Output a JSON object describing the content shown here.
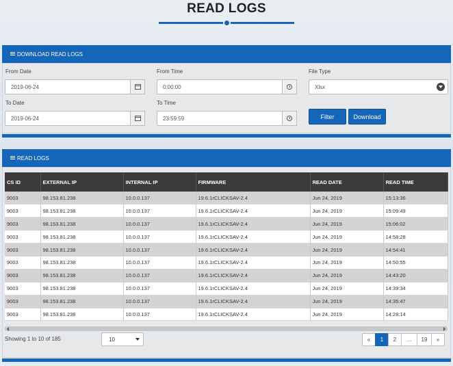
{
  "page_title": "READ LOGS",
  "download_panel": {
    "header": "DOWNLOAD READ LOGS",
    "from_date_label": "From Date",
    "from_date_value": "2019-06-24",
    "to_date_label": "To Date",
    "to_date_value": "2019-06-24",
    "from_time_label": "From Time",
    "from_time_value": "0:00:00",
    "to_time_label": "To Time",
    "to_time_value": "23:59:59",
    "file_type_label": "File Type",
    "file_type_value": "Xlsx",
    "filter_label": "Filter",
    "download_label": "Download"
  },
  "logs_panel": {
    "header": "READ LOGS",
    "columns": [
      "CS ID",
      "EXTERNAL IP",
      "INTERNAL IP",
      "FIRMWARE",
      "READ DATE",
      "READ TIME"
    ],
    "rows": [
      [
        "9003",
        "98.153.81.238",
        "10.0.0.137",
        "19.6.1rCLICKSAV-2.4",
        "Jun 24, 2019",
        "15:13:36"
      ],
      [
        "9003",
        "98.153.81.238",
        "10.0.0.137",
        "19.6.1rCLICKSAV-2.4",
        "Jun 24, 2019",
        "15:09:49"
      ],
      [
        "9003",
        "98.153.81.238",
        "10.0.0.137",
        "19.6.1rCLICKSAV-2.4",
        "Jun 24, 2019",
        "15:06:02"
      ],
      [
        "9003",
        "98.153.81.238",
        "10.0.0.137",
        "19.6.1rCLICKSAV-2.4",
        "Jun 24, 2019",
        "14:58:28"
      ],
      [
        "9003",
        "98.153.81.238",
        "10.0.0.137",
        "19.6.1rCLICKSAV-2.4",
        "Jun 24, 2019",
        "14:54:41"
      ],
      [
        "9003",
        "98.153.81.238",
        "10.0.0.137",
        "19.6.1rCLICKSAV-2.4",
        "Jun 24, 2019",
        "14:50:55"
      ],
      [
        "9003",
        "98.153.81.238",
        "10.0.0.137",
        "19.6.1rCLICKSAV-2.4",
        "Jun 24, 2019",
        "14:43:20"
      ],
      [
        "9003",
        "98.153.81.238",
        "10.0.0.137",
        "19.6.1rCLICKSAV-2.4",
        "Jun 24, 2019",
        "14:39:34"
      ],
      [
        "9003",
        "98.153.81.238",
        "10.0.0.137",
        "19.6.1rCLICKSAV-2.4",
        "Jun 24, 2019",
        "14:35:47"
      ],
      [
        "9003",
        "98.153.81.238",
        "10.0.0.137",
        "19.6.1rCLICKSAV-2.4",
        "Jun 24, 2019",
        "14:28:14"
      ]
    ],
    "showing_text": "Showing 1 to 10 of 185",
    "page_size": "10",
    "pagination": [
      "«",
      "1",
      "2",
      "...",
      "19",
      "»"
    ],
    "active_page": "1"
  },
  "colors": {
    "primary": "#1565b9",
    "table_header": "#3b3b3b",
    "row_alt": "#d3d3d3"
  }
}
